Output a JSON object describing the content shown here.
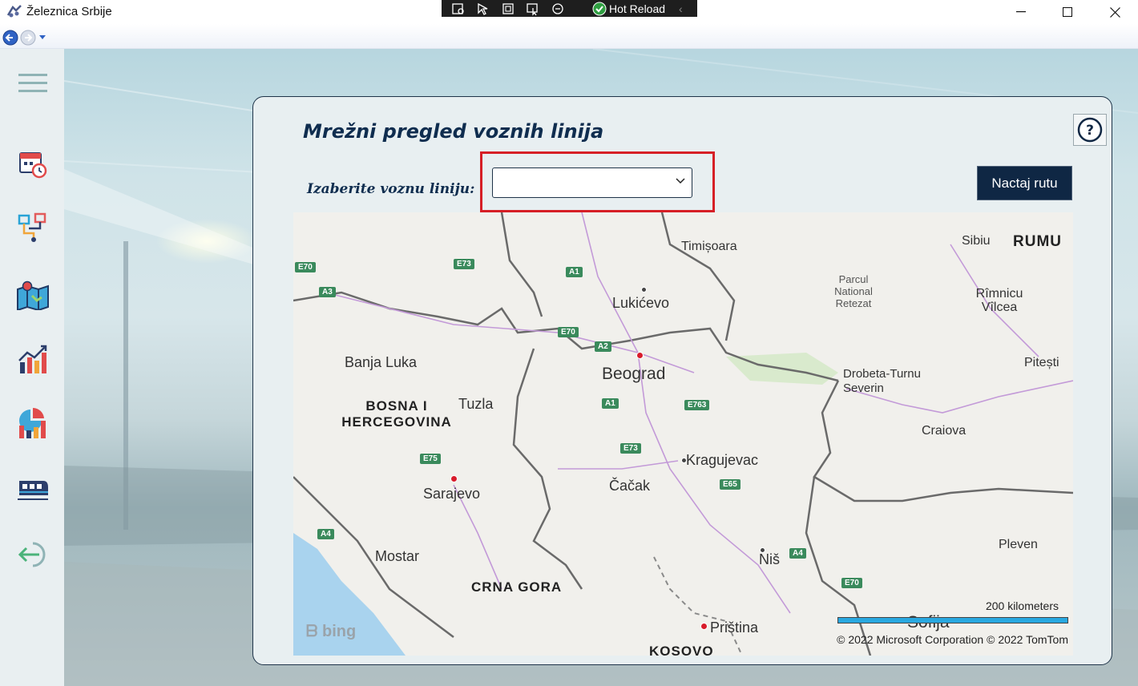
{
  "window": {
    "title": "Železnica Srbije",
    "hot_reload": "Hot Reload"
  },
  "main": {
    "page_title": "Mrežni pregled voznih linija",
    "select_label": "Izaberite voznu liniju:",
    "select_value": "",
    "draw_button": "Nactaj rutu",
    "help": "?"
  },
  "sidebar": {
    "items": [
      {
        "name": "menu-icon"
      },
      {
        "name": "calendar-icon"
      },
      {
        "name": "route-icon"
      },
      {
        "name": "map-icon"
      },
      {
        "name": "chart-icon"
      },
      {
        "name": "stats-icon"
      },
      {
        "name": "train-icon"
      },
      {
        "name": "logout-icon"
      }
    ]
  },
  "map": {
    "cities": {
      "timisoara": "Timișoara",
      "lukicevo": "Lukićevo",
      "beograd": "Beograd",
      "banja_luka": "Banja Luka",
      "tuzla": "Tuzla",
      "kragujevac": "Kragujevac",
      "cacak": "Čačak",
      "sarajevo": "Sarajevo",
      "mostar": "Mostar",
      "nis": "Niš",
      "pristina": "Priština",
      "sibiu": "Sibiu",
      "rimnicu": "Rîmnicu Vîlcea",
      "drobeta": "Drobeta-Turnu Severin",
      "craiova": "Craiova",
      "pitesti": "Pitești",
      "pleven": "Pleven",
      "sofia": "Sofija"
    },
    "countries": {
      "bih": "BOSNA I HERCEGOVINA",
      "crna_gora": "CRNA GORA",
      "kosovo": "KOSOVO",
      "romania": "RUMU"
    },
    "park": "Parcul National Retezat",
    "roads": [
      "E70",
      "E73",
      "A1",
      "A3",
      "E70",
      "A2",
      "A1",
      "E763",
      "E73",
      "E75",
      "E65",
      "A4",
      "A4",
      "E70"
    ],
    "scale": "200 kilometers",
    "copyright": "© 2022 Microsoft Corporation   © 2022 TomTom",
    "provider": "bing"
  },
  "colors": {
    "accent": "#0f2744",
    "highlight": "#d61f26",
    "title": "#0f2d4f"
  }
}
